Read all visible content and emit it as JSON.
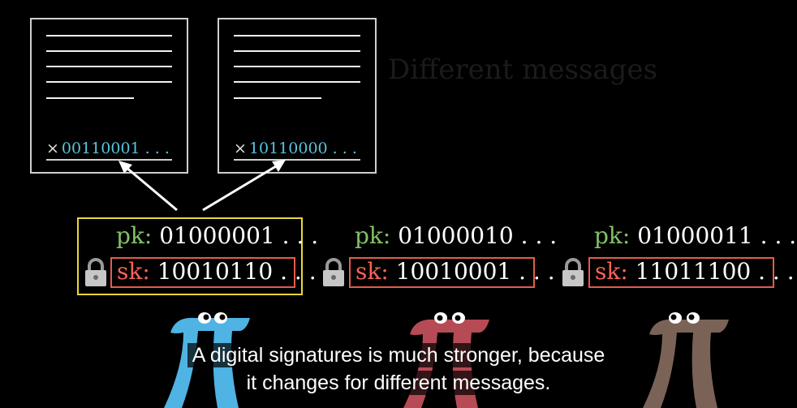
{
  "ghost_heading": "Different messages",
  "documents": [
    {
      "signature": "00110001 . . .",
      "times": "×"
    },
    {
      "signature": "10110000 . . .",
      "times": "×"
    }
  ],
  "keypairs": [
    {
      "pk_label": "pk:",
      "pk_value": "01000001 . . .",
      "sk_label": "sk:",
      "sk_value": "10010110 . . .",
      "selected": true
    },
    {
      "pk_label": "pk:",
      "pk_value": "01000010 . . .",
      "sk_label": "sk:",
      "sk_value": "10010001 . . .",
      "selected": false
    },
    {
      "pk_label": "pk:",
      "pk_value": "01000011 . . .",
      "sk_label": "sk:",
      "sk_value": "11011100 . . .",
      "selected": false
    }
  ],
  "characters": [
    {
      "name": "blue-pi",
      "color": "#4fb3e3"
    },
    {
      "name": "red-pi",
      "color": "#b64b55"
    },
    {
      "name": "brown-pi",
      "color": "#7a6356"
    }
  ],
  "subtitles": {
    "line1": "A digital signatures is much stronger, because",
    "line2": "it changes for different messages."
  },
  "colors": {
    "background": "#000000",
    "pk": "#83c167",
    "sk": "#fc6255",
    "signature": "#58c4dd",
    "highlight": "#e8d83a"
  }
}
